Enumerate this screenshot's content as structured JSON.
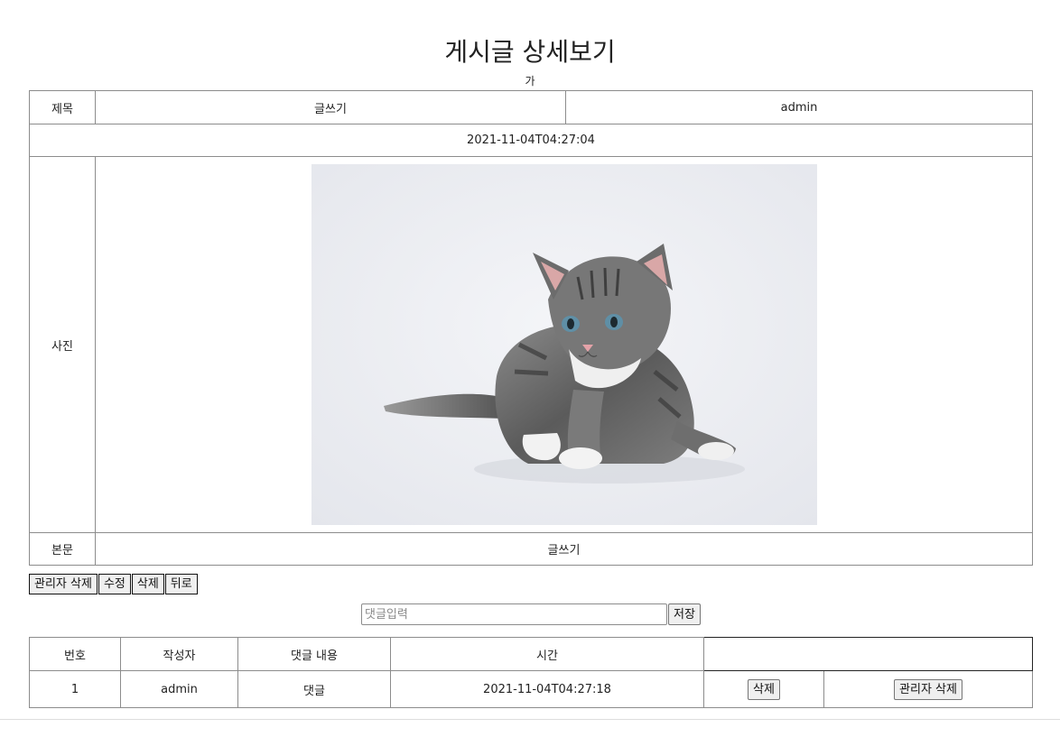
{
  "page": {
    "title": "게시글 상세보기",
    "subtitle": "가"
  },
  "post": {
    "title_label": "제목",
    "title_value": "글쓰기",
    "author": "admin",
    "date": "2021-11-04T04:27:04",
    "photo_label": "사진",
    "body_label": "본문",
    "body_value": "글쓰기"
  },
  "actions": {
    "admin_delete": "관리자 삭제",
    "edit": "수정",
    "delete": "삭제",
    "back": "뒤로"
  },
  "comment_form": {
    "placeholder": "댓글입력",
    "save": "저장"
  },
  "comments": {
    "headers": [
      "번호",
      "작성자",
      "댓글 내용",
      "시간",
      ""
    ],
    "rows": [
      {
        "no": "1",
        "author": "admin",
        "content": "댓글",
        "time": "2021-11-04T04:27:18",
        "delete": "삭제",
        "admin_delete": "관리자 삭제"
      }
    ]
  }
}
